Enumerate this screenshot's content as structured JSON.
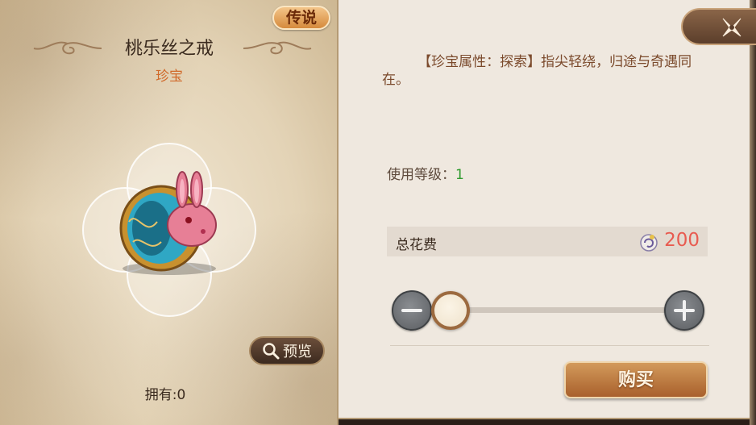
{
  "item": {
    "rarity": "传说",
    "name": "桃乐丝之戒",
    "type": "珍宝",
    "owned_label": "拥有:0"
  },
  "preview": {
    "label": "预览",
    "icon": "search-icon"
  },
  "close": {
    "icon": "close-icon"
  },
  "description": "【珍宝属性：探索】指尖轻绕，归途与奇遇同在。",
  "level": {
    "label": "使用等级：",
    "value": "1"
  },
  "cost": {
    "label": "总花费",
    "value": "200",
    "currency_icon": "currency-icon"
  },
  "quantity": {
    "selected_fraction": 0
  },
  "buy": {
    "label": "购买"
  },
  "colors": {
    "accent": "#d0692a",
    "cost": "#e85b50",
    "level": "#2e9a2e"
  }
}
